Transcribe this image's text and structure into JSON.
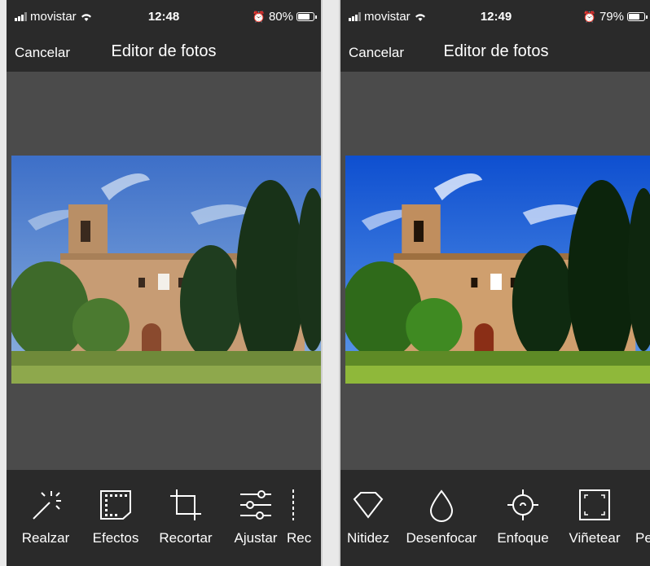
{
  "left": {
    "status": {
      "carrier": "movistar",
      "time": "12:48",
      "battery": "80%",
      "battery_level": 0.8
    },
    "nav": {
      "cancel": "Cancelar",
      "title": "Editor de fotos"
    },
    "tools": [
      {
        "label": "Realzar",
        "icon": "magic-wand-icon"
      },
      {
        "label": "Efectos",
        "icon": "film-frame-icon"
      },
      {
        "label": "Recortar",
        "icon": "crop-icon"
      },
      {
        "label": "Ajustar",
        "icon": "sliders-icon"
      },
      {
        "label": "Rec",
        "icon": "partial-tool-icon"
      }
    ]
  },
  "right": {
    "status": {
      "carrier": "movistar",
      "time": "12:49",
      "battery": "79%",
      "battery_level": 0.79
    },
    "nav": {
      "cancel": "Cancelar",
      "title": "Editor de fotos"
    },
    "tools": [
      {
        "label": "Nitidez",
        "icon": "diamond-icon"
      },
      {
        "label": "Desenfocar",
        "icon": "drop-icon"
      },
      {
        "label": "Enfoque",
        "icon": "crosshair-icon"
      },
      {
        "label": "Viñetear",
        "icon": "vignette-icon"
      },
      {
        "label": "Pe",
        "icon": "partial-tool-icon"
      }
    ]
  },
  "colors": {
    "bar_bg": "#2a2a2a",
    "canvas_bg": "#4b4b4b",
    "text": "#ffffff"
  }
}
